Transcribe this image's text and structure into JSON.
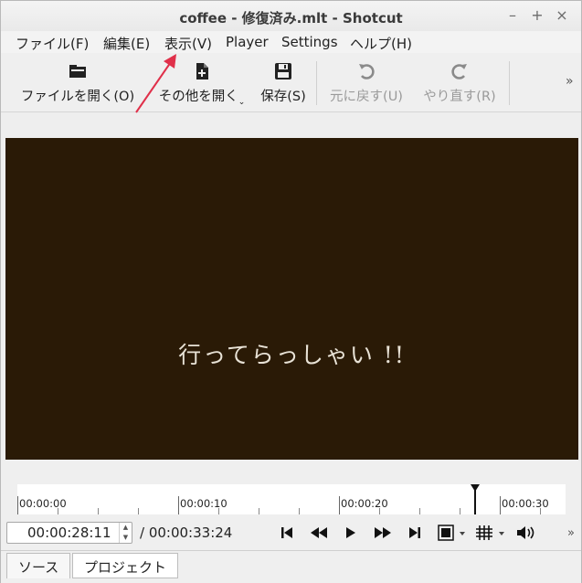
{
  "window": {
    "title": "coffee - 修復済み.mlt - Shotcut",
    "controls": {
      "minimize": "–",
      "maximize": "+",
      "close": "×"
    }
  },
  "menubar": {
    "items": [
      {
        "label": "ファイル(F)",
        "underline": "F"
      },
      {
        "label": "編集(E)",
        "underline": "E"
      },
      {
        "label": "表示(V)",
        "underline": "V"
      },
      {
        "label": "Player",
        "underline": "P"
      },
      {
        "label": "Settings",
        "underline": "S"
      },
      {
        "label": "ヘルプ(H)",
        "underline": "H"
      }
    ]
  },
  "toolbar": {
    "open_file": "ファイルを開く(O)",
    "open_other": "その他を開く",
    "save": "保存(S)",
    "undo": "元に戻す(U)",
    "redo": "やり直す(R)",
    "overflow": "»"
  },
  "viewer": {
    "subtitle": "行ってらっしゃい !!",
    "background": "#2a1a06"
  },
  "timeline": {
    "labels": [
      "00:00:00",
      "00:00:10",
      "00:00:20",
      "00:00:30"
    ]
  },
  "transport": {
    "current_time": "00:00:28:11",
    "total_time": "/ 00:00:33:24",
    "overflow": "»"
  },
  "tabs": [
    {
      "label": "ソース",
      "active": true
    },
    {
      "label": "プロジェクト",
      "active": false
    }
  ],
  "annotation": {
    "color": "#e0304a"
  }
}
